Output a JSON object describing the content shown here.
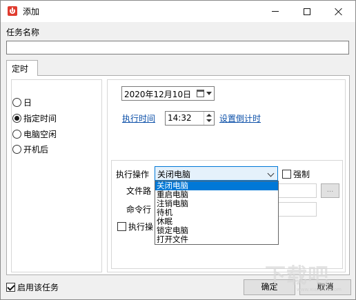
{
  "window": {
    "title": "添加"
  },
  "form": {
    "task_name_label": "任务名称",
    "task_name_value": "",
    "tab_label": "定时"
  },
  "schedule_options": [
    {
      "label": "日",
      "checked": false
    },
    {
      "label": "指定时间",
      "checked": true
    },
    {
      "label": "电脑空闲",
      "checked": false
    },
    {
      "label": "开机后",
      "checked": false
    }
  ],
  "date_picker": {
    "value": "2020年12月10日"
  },
  "time": {
    "exec_time_link": "执行时间",
    "value": "14:32",
    "countdown_link": "设置倒计时"
  },
  "action": {
    "label": "执行操作",
    "selected": "关闭电脑",
    "force_label": "强制",
    "force_checked": false,
    "file_path_label": "文件路",
    "cmd_label": "命令行",
    "exec_op_label": "执行操",
    "browse_label": "...",
    "options": [
      "关闭电脑",
      "重启电脑",
      "注销电脑",
      "待机",
      "休眠",
      "锁定电脑",
      "打开文件"
    ]
  },
  "footer": {
    "enable_label": "启用该任务",
    "enable_checked": true,
    "ok_label": "确定",
    "cancel_label": "取消"
  },
  "watermark": {
    "text": "下载吧",
    "sub": "www.xiazaiba.com"
  }
}
